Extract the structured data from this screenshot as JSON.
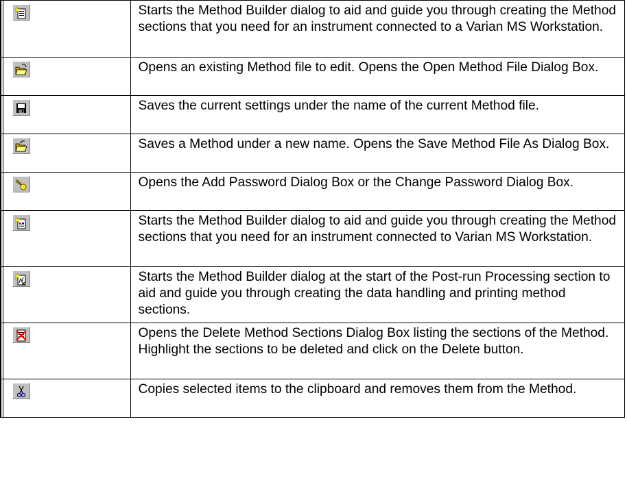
{
  "rows": [
    {
      "icon": "method-builder-icon",
      "text": "Starts the Method Builder dialog to aid and guide you through creating the Method sections that you need for an instrument connected to a Varian MS Workstation."
    },
    {
      "icon": "open-folder-icon",
      "text": "Opens an existing Method file to edit. Opens the Open Method File Dialog Box."
    },
    {
      "icon": "save-disk-icon",
      "text": "Saves the current settings under the name of the current Method file."
    },
    {
      "icon": "save-as-folder-icon",
      "text": "Saves a Method under a new name. Opens the Save Method File As Dialog Box."
    },
    {
      "icon": "key-icon",
      "text": "Opens the Add Password Dialog Box or the Change Password Dialog Box."
    },
    {
      "icon": "method-builder-wizard-icon",
      "text": "Starts the Method Builder dialog to aid and guide you through creating the Method sections that you need for an instrument connected to Varian MS Workstation."
    },
    {
      "icon": "postrun-builder-icon",
      "text": "Starts the Method Builder dialog at the start of the Post-run Processing section to aid and guide you through creating the data handling and printing method sections."
    },
    {
      "icon": "delete-sections-icon",
      "text": "Opens the Delete Method Sections Dialog Box listing the sections of the Method. Highlight the sections to be deleted and click on the Delete button."
    },
    {
      "icon": "scissors-icon",
      "text": "Copies selected items to the clipboard and removes them from the Method."
    }
  ]
}
